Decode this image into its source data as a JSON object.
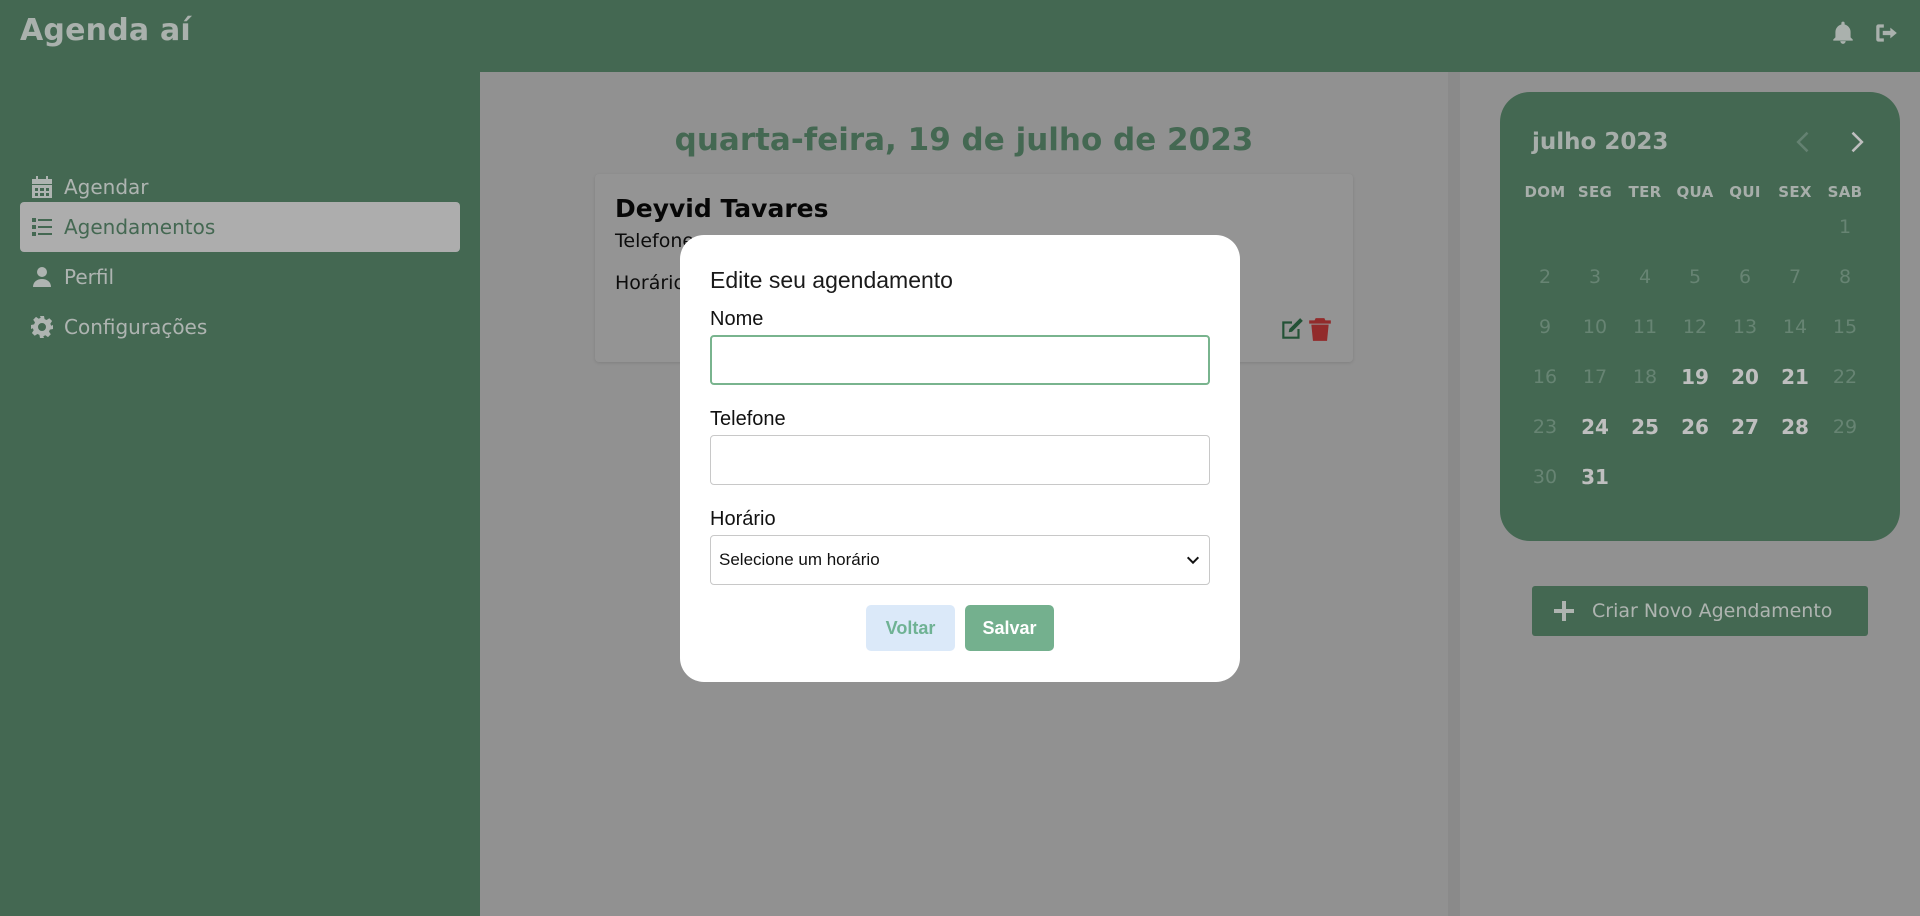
{
  "app": {
    "title": "Agenda aí"
  },
  "header": {
    "icons": [
      "bell-icon",
      "logout-icon"
    ]
  },
  "sidebar": {
    "items": [
      {
        "label": "Agendar",
        "icon": "calendar-icon",
        "active": false
      },
      {
        "label": "Agendamentos",
        "icon": "list-icon",
        "active": true
      },
      {
        "label": "Perfil",
        "icon": "user-icon",
        "active": false
      },
      {
        "label": "Configurações",
        "icon": "gear-icon",
        "active": false
      }
    ]
  },
  "main": {
    "date_title": "quarta-feira, 19 de julho de 2023",
    "appointment": {
      "name": "Deyvid Tavares",
      "phone_label": "Telefone",
      "time_label": "Horário"
    }
  },
  "calendar": {
    "month_label": "julho 2023",
    "weekdays": [
      "DOM",
      "SEG",
      "TER",
      "QUA",
      "QUI",
      "SEX",
      "SAB"
    ],
    "weeks": [
      [
        "",
        "",
        "",
        "",
        "",
        "",
        "1"
      ],
      [
        "2",
        "3",
        "4",
        "5",
        "6",
        "7",
        "8"
      ],
      [
        "9",
        "10",
        "11",
        "12",
        "13",
        "14",
        "15"
      ],
      [
        "16",
        "17",
        "18",
        "19",
        "20",
        "21",
        "22"
      ],
      [
        "23",
        "24",
        "25",
        "26",
        "27",
        "28",
        "29"
      ],
      [
        "30",
        "31",
        "",
        "",
        "",
        "",
        ""
      ]
    ],
    "available_days": [
      "19",
      "20",
      "21",
      "24",
      "25",
      "26",
      "27",
      "28",
      "31"
    ]
  },
  "new_appointment_button": {
    "label": "Criar Novo Agendamento"
  },
  "modal": {
    "title": "Edite seu agendamento",
    "name_label": "Nome",
    "name_value": "",
    "phone_label": "Telefone",
    "phone_value": "",
    "time_label": "Horário",
    "time_selected": "Selecione um horário",
    "back_label": "Voltar",
    "save_label": "Salvar"
  },
  "colors": {
    "brand_green": "#5b8b6e",
    "save_green": "#74b08e",
    "back_blue": "#dbe9f9",
    "delete_red": "#c33a3a"
  }
}
